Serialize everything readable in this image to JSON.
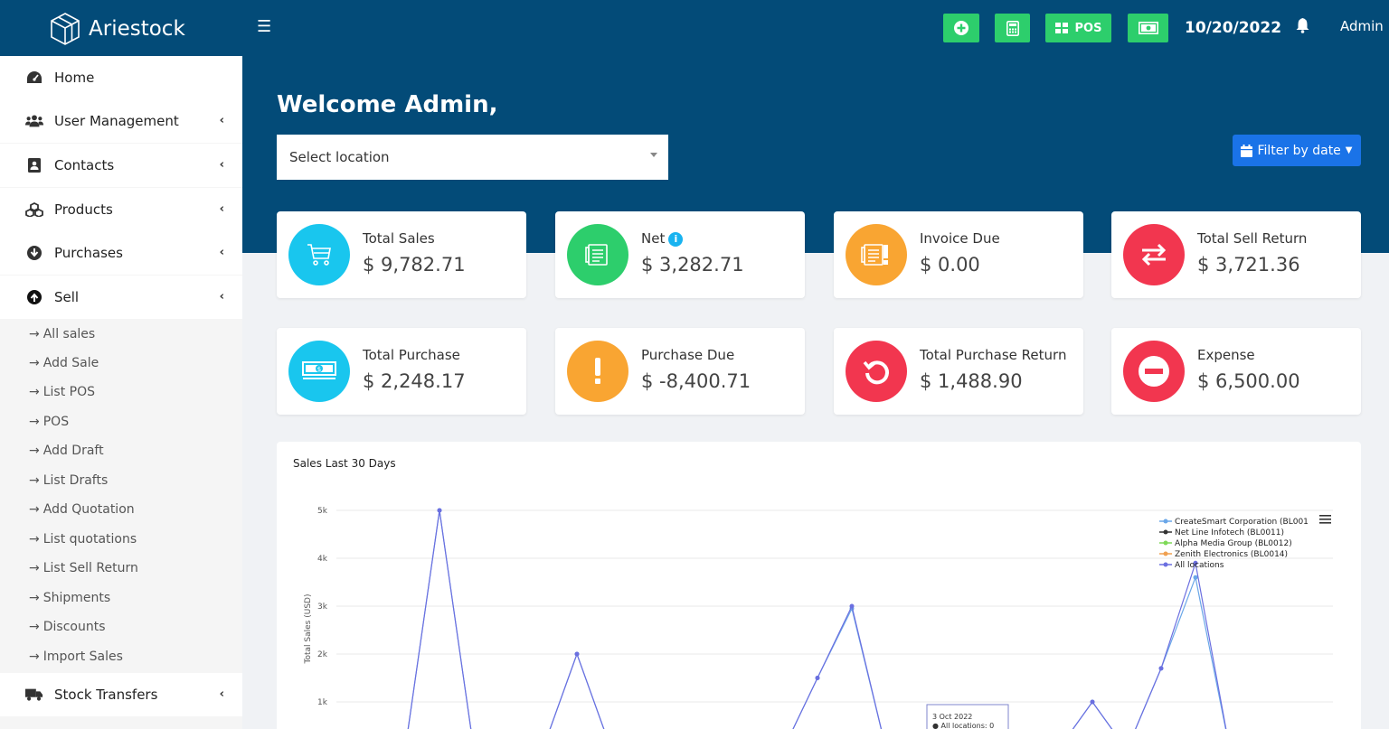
{
  "brand": {
    "name": "Ariestock"
  },
  "topbar": {
    "pos_label": "POS",
    "date": "10/20/2022",
    "user": "Admin"
  },
  "sidebar": {
    "items": [
      {
        "label": "Home",
        "icon": "dashboard-icon"
      },
      {
        "label": "User Management",
        "icon": "users-icon"
      },
      {
        "label": "Contacts",
        "icon": "address-book-icon"
      },
      {
        "label": "Products",
        "icon": "cubes-icon"
      },
      {
        "label": "Purchases",
        "icon": "arrow-circle-down-icon"
      },
      {
        "label": "Sell",
        "icon": "arrow-circle-up-icon"
      },
      {
        "label": "Stock Transfers",
        "icon": "truck-icon"
      }
    ],
    "sell_submenu": [
      "All sales",
      "Add Sale",
      "List POS",
      "POS",
      "Add Draft",
      "List Drafts",
      "Add Quotation",
      "List quotations",
      "List Sell Return",
      "Shipments",
      "Discounts",
      "Import Sales"
    ]
  },
  "main": {
    "welcome": "Welcome Admin,",
    "location_placeholder": "Select location",
    "filter_label": "Filter by date",
    "cards": [
      {
        "label": "Total Sales",
        "value": "$ 9,782.71",
        "color": "#19c6ee"
      },
      {
        "label": "Net",
        "value": "$ 3,282.71",
        "color": "#2dce6c"
      },
      {
        "label": "Invoice Due",
        "value": "$ 0.00",
        "color": "#f9a532"
      },
      {
        "label": "Total Sell Return",
        "value": "$ 3,721.36",
        "color": "#f2364f"
      },
      {
        "label": "Total Purchase",
        "value": "$ 2,248.17",
        "color": "#19c6ee"
      },
      {
        "label": "Purchase Due",
        "value": "$ -8,400.71",
        "color": "#f9a532"
      },
      {
        "label": "Total Purchase Return",
        "value": "$ 1,488.90",
        "color": "#f2364f"
      },
      {
        "label": "Expense",
        "value": "$ 6,500.00",
        "color": "#f2364f"
      }
    ]
  },
  "colors": {
    "brand": "#034b78",
    "green": "#2dce6c",
    "blue": "#1a73e8"
  },
  "chart_data": {
    "type": "line",
    "title": "Sales Last 30 Days",
    "ylabel": "Total Sales (USD)",
    "yticks": [
      "1k",
      "2k",
      "3k",
      "4k",
      "5k"
    ],
    "ylim": [
      0,
      5000
    ],
    "x": [
      0,
      1,
      2,
      3,
      4,
      5,
      6,
      7,
      8,
      9,
      10,
      11,
      12,
      13,
      14,
      15,
      16,
      17,
      18,
      19,
      20,
      21,
      22,
      23,
      24,
      25,
      26,
      27,
      28,
      29
    ],
    "legend_position": "top-right",
    "series": [
      {
        "name": "CreateSmart Corporation (BL001",
        "color": "#6aa7e8",
        "values": [
          0,
          0,
          0,
          5000,
          0,
          0,
          0,
          2000,
          0,
          0,
          0,
          0,
          0,
          0,
          1500,
          2950,
          0,
          0,
          0,
          0,
          0,
          0,
          1000,
          0,
          1700,
          3600,
          0,
          0,
          0,
          0
        ]
      },
      {
        "name": "Net Line Infotech (BL0011)",
        "color": "#333333",
        "values": [
          0,
          0,
          0,
          0,
          0,
          0,
          0,
          0,
          0,
          0,
          0,
          0,
          0,
          0,
          0,
          0,
          0,
          0,
          0,
          0,
          0,
          0,
          0,
          0,
          0,
          0,
          0,
          0,
          0,
          0
        ]
      },
      {
        "name": "Alpha Media Group (BL0012)",
        "color": "#7ed957",
        "values": [
          0,
          0,
          0,
          0,
          0,
          0,
          0,
          0,
          0,
          0,
          0,
          0,
          0,
          0,
          0,
          0,
          0,
          0,
          0,
          0,
          0,
          0,
          0,
          0,
          0,
          0,
          0,
          0,
          0,
          0
        ]
      },
      {
        "name": "Zenith Electronics (BL0014)",
        "color": "#f0a050",
        "values": [
          0,
          0,
          0,
          0,
          0,
          0,
          0,
          0,
          0,
          0,
          0,
          0,
          0,
          0,
          0,
          0,
          0,
          0,
          0,
          0,
          0,
          0,
          0,
          0,
          0,
          0,
          0,
          0,
          0,
          0
        ]
      },
      {
        "name": "All locations",
        "color": "#6b6fe0",
        "values": [
          0,
          0,
          0,
          5000,
          0,
          0,
          0,
          2000,
          0,
          0,
          0,
          0,
          0,
          0,
          1500,
          3000,
          0,
          0,
          0,
          0,
          0,
          0,
          1000,
          0,
          1700,
          3900,
          0,
          0,
          0,
          0
        ]
      }
    ],
    "tooltip": {
      "date": "3 Oct 2022",
      "text": "All locations: 0"
    }
  }
}
